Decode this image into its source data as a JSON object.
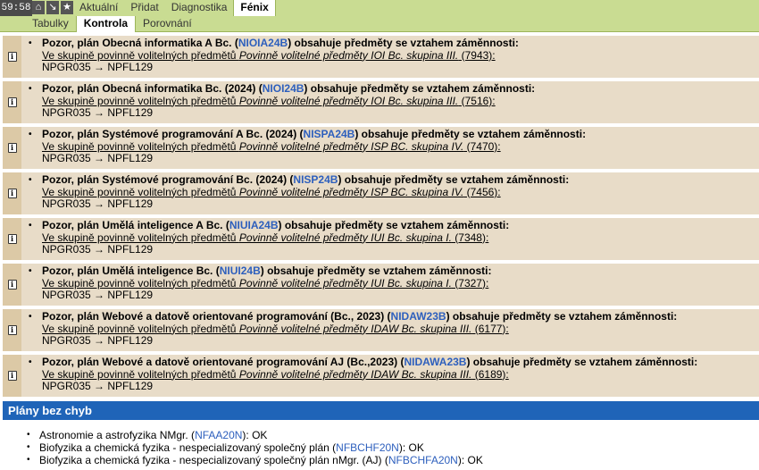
{
  "topbar": {
    "timer": "59:58",
    "icons": [
      "home-icon",
      "arrow-icon",
      "star-icon"
    ],
    "menu": [
      "Aktuální",
      "Přidat",
      "Diagnostika",
      "Fénix"
    ],
    "active_menu": "Fénix"
  },
  "subbar": {
    "tabs": [
      "Tabulky",
      "Kontrola",
      "Porovnání"
    ],
    "active_tab": "Kontrola"
  },
  "warnings": [
    {
      "pre": "Pozor, plán Obecná informatika A Bc. (",
      "code": "NIOIA24B",
      "post": ") obsahuje předměty se vztahem záměnnosti:",
      "group_pre": "Ve skupině povinně volitelných předmětů ",
      "group_name": "Povinně volitelné předměty IOI Bc. skupina III.",
      "group_num": " (7943):",
      "pair": "NPGR035 → NPFL129"
    },
    {
      "pre": "Pozor, plán Obecná informatika Bc. (2024) (",
      "code": "NIOI24B",
      "post": ") obsahuje předměty se vztahem záměnnosti:",
      "group_pre": "Ve skupině povinně volitelných předmětů ",
      "group_name": "Povinně volitelné předměty IOI Bc. skupina III.",
      "group_num": " (7516):",
      "pair": "NPGR035 → NPFL129"
    },
    {
      "pre": "Pozor, plán Systémové programování A Bc. (2024) (",
      "code": "NISPA24B",
      "post": ") obsahuje předměty se vztahem záměnnosti:",
      "group_pre": "Ve skupině povinně volitelných předmětů ",
      "group_name": "Povinně volitelné předměty ISP BC. skupina IV.",
      "group_num": " (7470):",
      "pair": "NPGR035 → NPFL129"
    },
    {
      "pre": "Pozor, plán Systémové programování Bc. (2024) (",
      "code": "NISP24B",
      "post": ") obsahuje předměty se vztahem záměnnosti:",
      "group_pre": "Ve skupině povinně volitelných předmětů ",
      "group_name": "Povinně volitelné předměty ISP BC. skupina IV.",
      "group_num": " (7456):",
      "pair": "NPGR035 → NPFL129"
    },
    {
      "pre": "Pozor, plán Umělá inteligence A Bc. (",
      "code": "NIUIA24B",
      "post": ") obsahuje předměty se vztahem záměnnosti:",
      "group_pre": "Ve skupině povinně volitelných předmětů ",
      "group_name": "Povinně volitelné předměty IUI Bc. skupina I.",
      "group_num": " (7348):",
      "pair": "NPGR035 → NPFL129"
    },
    {
      "pre": "Pozor, plán Umělá inteligence Bc. (",
      "code": "NIUI24B",
      "post": ") obsahuje předměty se vztahem záměnnosti:",
      "group_pre": "Ve skupině povinně volitelných předmětů ",
      "group_name": "Povinně volitelné předměty IUI Bc. skupina I.",
      "group_num": " (7327):",
      "pair": "NPGR035 → NPFL129"
    },
    {
      "pre": "Pozor, plán Webové a datově orientované programování (Bc., 2023) (",
      "code": "NIDAW23B",
      "post": ") obsahuje předměty se vztahem záměnnosti:",
      "group_pre": "Ve skupině povinně volitelných předmětů ",
      "group_name": "Povinně volitelné předměty IDAW Bc. skupina III.",
      "group_num": " (6177):",
      "pair": "NPGR035 → NPFL129"
    },
    {
      "pre": "Pozor, plán Webové a datově orientované programování AJ (Bc.,2023) (",
      "code": "NIDAWA23B",
      "post": ") obsahuje předměty se vztahem záměnnosti:",
      "group_pre": "Ve skupině povinně volitelných předmětů ",
      "group_name": "Povinně volitelné předměty IDAW Bc. skupina III.",
      "group_num": " (6189):",
      "pair": "NPGR035 → NPFL129"
    }
  ],
  "ok_section": {
    "title": "Plány bez chyb",
    "items": [
      {
        "pre": "Astronomie a astrofyzika NMgr. (",
        "code": "NFAA20N",
        "post": "): OK"
      },
      {
        "pre": "Biofyzika a chemická fyzika - nespecializovaný společný plán (",
        "code": "NFBCHF20N",
        "post": "): OK"
      },
      {
        "pre": "Biofyzika a chemická fyzika - nespecializovaný společný plán nMgr. (AJ) (",
        "code": "NFBCHFA20N",
        "post": "): OK"
      }
    ]
  }
}
